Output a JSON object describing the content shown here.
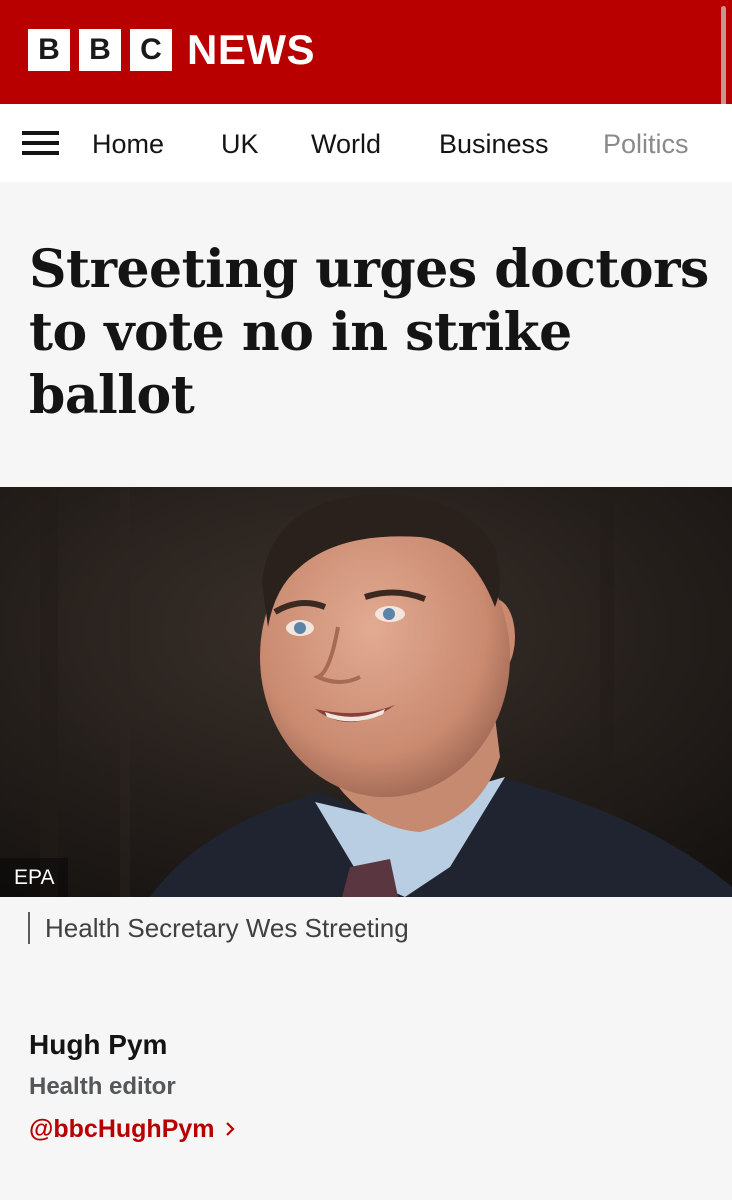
{
  "brand": {
    "letters": [
      "B",
      "B",
      "C"
    ],
    "name": "NEWS",
    "color": "#b80000"
  },
  "nav": {
    "menu_icon": "hamburger-menu-icon",
    "items": [
      {
        "label": "Home"
      },
      {
        "label": "UK"
      },
      {
        "label": "World"
      },
      {
        "label": "Business"
      },
      {
        "label": "Politics"
      }
    ]
  },
  "article": {
    "headline": "Streeting urges doctors to vote no in strike ballot",
    "image": {
      "credit": "EPA",
      "caption": "Health Secretary Wes Streeting"
    },
    "byline": {
      "name": "Hugh Pym",
      "role": "Health editor",
      "handle": "@bbcHughPym",
      "handle_icon": "chevron-right-icon"
    }
  }
}
